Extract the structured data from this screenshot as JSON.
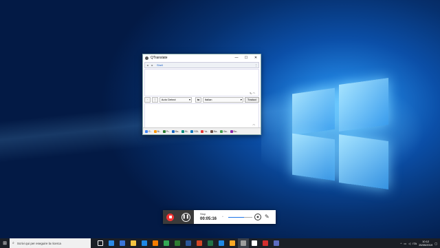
{
  "window": {
    "title": "QTranslate",
    "link": "Shell",
    "source_lang": "Auto Detect",
    "target_lang": "Italian",
    "translate_button": "Traduci"
  },
  "statusbar_items": [
    {
      "label": "G..",
      "color": "#4285f4"
    },
    {
      "label": "Bi..",
      "color": "#ff9800"
    },
    {
      "label": "Pr..",
      "color": "#2e7d32"
    },
    {
      "label": "Ba..",
      "color": "#1565c0"
    },
    {
      "label": "Bi..",
      "color": "#00897b"
    },
    {
      "label": "SDL",
      "color": "#0277bd"
    },
    {
      "label": "Ya..",
      "color": "#e53935"
    },
    {
      "label": "Ba..",
      "color": "#6d4c41"
    },
    {
      "label": "Ba..",
      "color": "#43a047"
    },
    {
      "label": "Ba..",
      "color": "#8e24aa"
    }
  ],
  "recorder": {
    "label": "Stop",
    "time": "00:05:16",
    "volume": 0.65,
    "stop_icon": "stop-icon",
    "pause_icon": "pause-icon"
  },
  "taskbar": {
    "search_placeholder": "Scrivi qui per eseguire la ricerca",
    "apps": [
      {
        "name": "task-view",
        "color": "#ffffff"
      },
      {
        "name": "edge",
        "color": "#2b8ae6"
      },
      {
        "name": "store",
        "color": "#3a74d8"
      },
      {
        "name": "explorer",
        "color": "#f4c542"
      },
      {
        "name": "mail",
        "color": "#1e88e5"
      },
      {
        "name": "vlc",
        "color": "#f57c00"
      },
      {
        "name": "chrome",
        "color": "#34a853"
      },
      {
        "name": "app-green",
        "color": "#2e7d32"
      },
      {
        "name": "word",
        "color": "#2b579a"
      },
      {
        "name": "powerpoint",
        "color": "#d24726"
      },
      {
        "name": "excel",
        "color": "#217346"
      },
      {
        "name": "app-blue",
        "color": "#1e88e5"
      },
      {
        "name": "app-ball",
        "color": "#f9a825"
      },
      {
        "name": "app-dark",
        "color": "#9e9e9e"
      },
      {
        "name": "settings",
        "color": "#ffffff"
      },
      {
        "name": "app-pdf",
        "color": "#d32f2f"
      },
      {
        "name": "app-photos",
        "color": "#5c6bc0"
      }
    ],
    "lang": "ITA",
    "time": "10:12",
    "date": "25/05/2019"
  }
}
